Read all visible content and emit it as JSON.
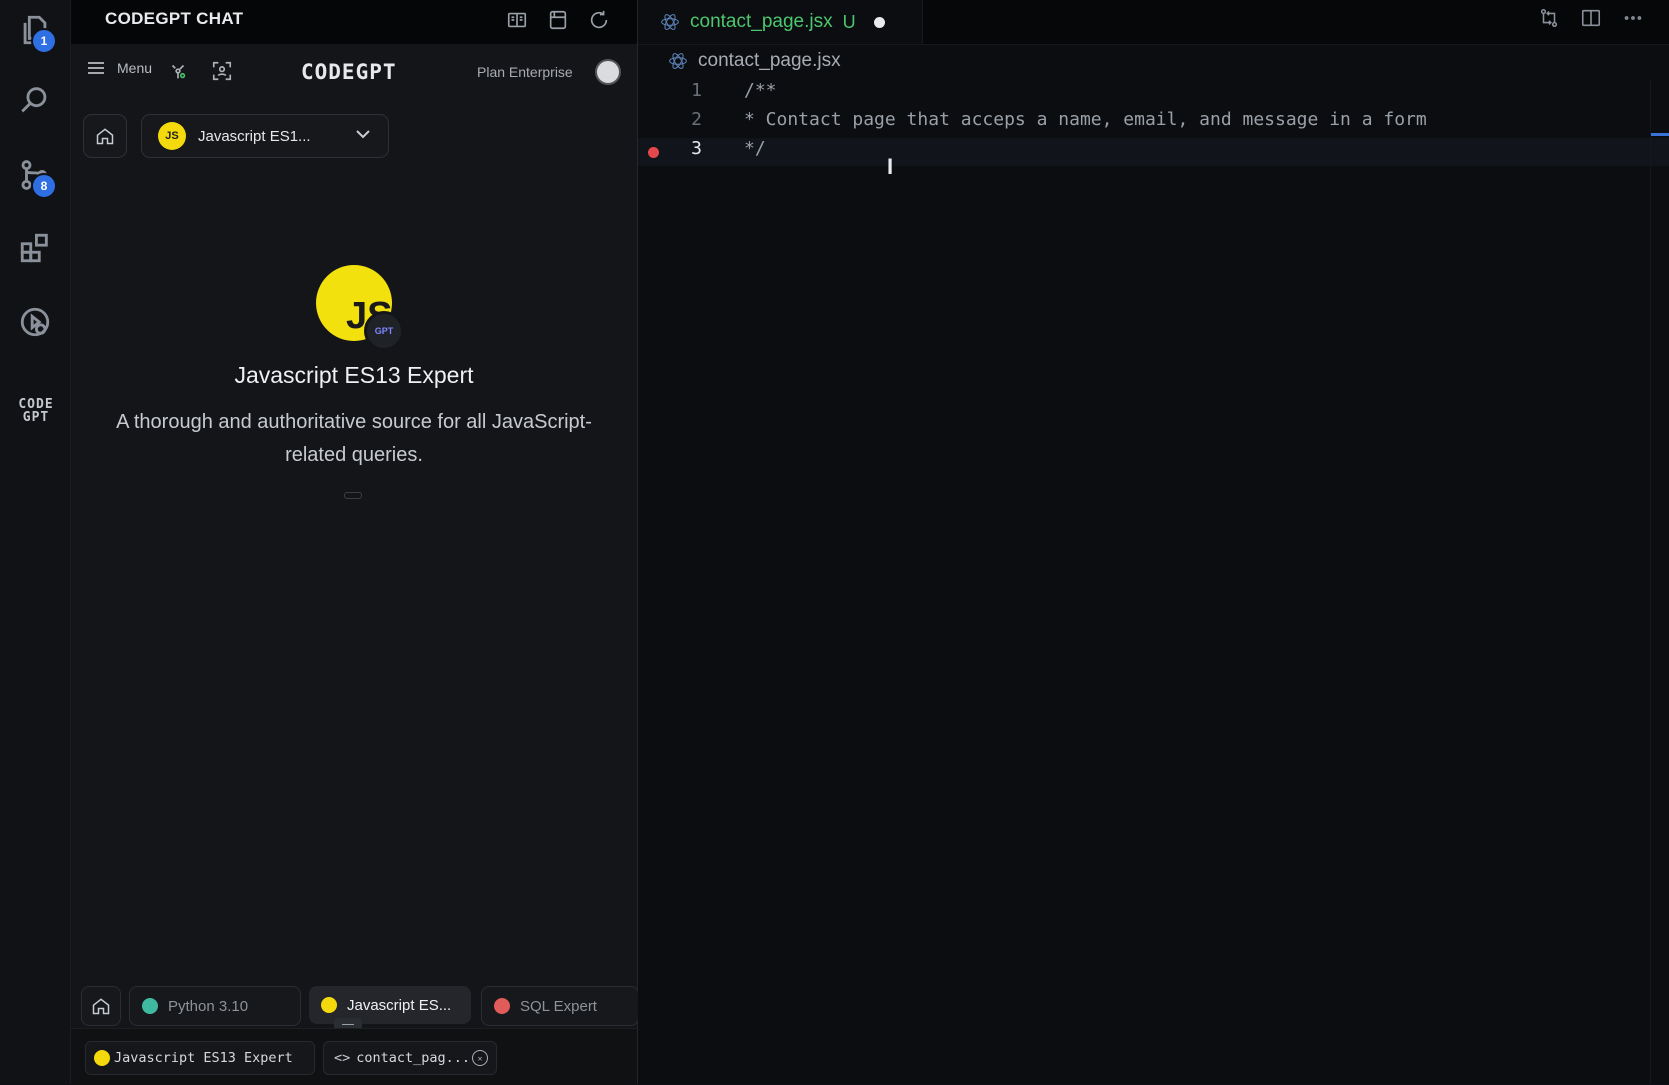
{
  "activity_bar": {
    "explorer_badge": "1",
    "source_control_badge": "8",
    "codegpt_logo": [
      "CODE",
      "GPT"
    ]
  },
  "panel": {
    "title": "CODEGPT CHAT",
    "menu_label": "Menu",
    "brand": "CODEGPT",
    "plan": "Plan Enterprise",
    "selected_agent_short": "Javascript ES1...",
    "agent_avatar_text": "JS",
    "agent_avatar_badge": "GPT",
    "agent_name": "Javascript ES13 Expert",
    "agent_description": "A thorough and authoritative source for all JavaScript-related queries.",
    "agent_tabs": [
      {
        "label": "Python 3.10",
        "color": "#3fb9a0"
      },
      {
        "label": "Javascript ES...",
        "color": "#f4d90c"
      },
      {
        "label": "SQL Expert",
        "color": "#e25b5b"
      }
    ],
    "context_agent": "Javascript ES13 Expert",
    "context_file": "contact_pag..."
  },
  "editor": {
    "tab_filename": "contact_page.jsx",
    "tab_status": "U",
    "breadcrumb": "contact_page.jsx",
    "lines": [
      {
        "number": "1",
        "text": "/**"
      },
      {
        "number": "2",
        "text": "* Contact page that acceps a name, email, and message in a form"
      },
      {
        "number": "3",
        "text": "*/"
      }
    ]
  }
}
